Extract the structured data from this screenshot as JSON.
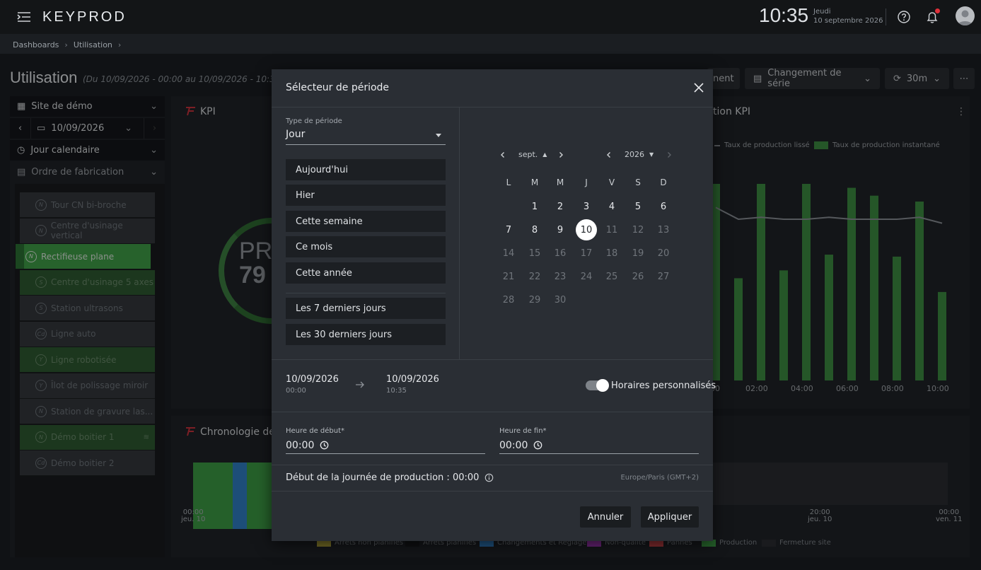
{
  "header": {
    "logo_text": "KEYPROD",
    "time": "10:35",
    "day": "Jeudi",
    "date": "10 septembre 2026"
  },
  "breadcrumb": [
    "Dashboards",
    "Utilisation"
  ],
  "page": {
    "title": "Utilisation",
    "range": "(Du 10/09/2026 - 00:00 au 10/09/2026 - 10:30)",
    "actions": {
      "changeover_partial": "nent",
      "changeover": "Changement de série",
      "refresh": "30m"
    }
  },
  "left_panel": {
    "site": "Site de démo",
    "date": "10/09/2026",
    "period": "Jour calendaire",
    "order": "Ordre de fabrication",
    "machines": [
      {
        "label": "Tour CN bi-broche",
        "icon": "N",
        "state": "grey"
      },
      {
        "label": "Centre d'usinage vertical",
        "icon": "N",
        "state": "grey"
      },
      {
        "label": "Rectifieuse plane",
        "icon": "N",
        "state": "active"
      },
      {
        "label": "Centre d'usinage 5 axes",
        "icon": "S",
        "state": "green"
      },
      {
        "label": "Station ultrasons",
        "icon": "S",
        "state": "grey"
      },
      {
        "label": "Ligne auto",
        "icon": "Cd",
        "state": "grey"
      },
      {
        "label": "Ligne robotisée",
        "icon": "Y",
        "state": "green"
      },
      {
        "label": "Îlot de polissage miroir",
        "icon": "Y",
        "state": "grey"
      },
      {
        "label": "Station de gravure las...",
        "icon": "N",
        "state": "grey"
      },
      {
        "label": "Démo boitier 1",
        "icon": "N",
        "state": "green"
      },
      {
        "label": "Démo boitier 2",
        "icon": "Cd",
        "state": "grey"
      }
    ]
  },
  "widgets": {
    "kpi_title": "KPI",
    "gauge_line1": "PR",
    "gauge_line2": "79",
    "chart_title_partial": "tion KPI",
    "legend_smooth": "Taux de production lissé",
    "legend_instant": "Taux de production instantané",
    "x_ticks": [
      "00",
      "02:00",
      "04:00",
      "06:00",
      "08:00",
      "10:00"
    ],
    "timeline_title": "Chronologie des",
    "timeline_ticks": [
      {
        "time": "00:00",
        "day": "jeu. 10"
      },
      {
        "time": "20:00",
        "day": "jeu. 10"
      },
      {
        "time": "00:00",
        "day": "ven. 11"
      }
    ],
    "bottom_legend": [
      {
        "label": "Arrêts non planifiés",
        "color": "#b0a43a"
      },
      {
        "label": "Arrêts planifiés",
        "color": "#17191c"
      },
      {
        "label": "Changements et Réglages",
        "color": "#2f7fc4"
      },
      {
        "label": "Non-qualité",
        "color": "#a037b5"
      },
      {
        "label": "Pannes",
        "color": "#c9444a"
      },
      {
        "label": "Production",
        "color": "#3c9c44"
      },
      {
        "label": "Fermeture site",
        "color": "#2a2d31"
      }
    ]
  },
  "chart_data": {
    "type": "bar",
    "title": "",
    "series": [
      {
        "name": "Taux de production instantané",
        "values": [
          100,
          52,
          100,
          56,
          100,
          64,
          98,
          94,
          63,
          91,
          45
        ]
      },
      {
        "name": "Taux de production lissé",
        "values": [
          88,
          82,
          83,
          82,
          82,
          83,
          82,
          82,
          82,
          83,
          80
        ]
      }
    ]
  },
  "modal": {
    "title": "Sélecteur de période",
    "period_type_label": "Type de période",
    "period_type_value": "Jour",
    "presets": [
      "Aujourd'hui",
      "Hier",
      "Cette semaine",
      "Ce mois",
      "Cette année"
    ],
    "presets_rolling": [
      "Les 7 derniers jours",
      "Les 30 derniers jours"
    ],
    "calendar": {
      "month": "sept.",
      "year": "2026",
      "weekdays": [
        "L",
        "M",
        "M",
        "J",
        "V",
        "S",
        "D"
      ],
      "selected_day": "10",
      "weeks": [
        [
          "",
          "1",
          "2",
          "3",
          "4",
          "5",
          "6"
        ],
        [
          "7",
          "8",
          "9",
          "10",
          "11",
          "12",
          "13"
        ],
        [
          "14",
          "15",
          "16",
          "17",
          "18",
          "19",
          "20"
        ],
        [
          "21",
          "22",
          "23",
          "24",
          "25",
          "26",
          "27"
        ],
        [
          "28",
          "29",
          "30",
          "",
          "",
          "",
          ""
        ]
      ],
      "enabled_until": "10"
    },
    "range": {
      "start_date": "10/09/2026",
      "start_time": "00:00",
      "end_date": "10/09/2026",
      "end_time": "10:35"
    },
    "custom_hours_label": "Horaires personnalisés",
    "custom_hours_on": true,
    "start_label": "Heure de début*",
    "start_value": "00:00",
    "end_label": "Heure de fin*",
    "end_value": "00:00",
    "production_start": "Début de la journée de production : 00:00",
    "timezone": "Europe/Paris (GMT+2)",
    "cancel": "Annuler",
    "apply": "Appliquer"
  }
}
